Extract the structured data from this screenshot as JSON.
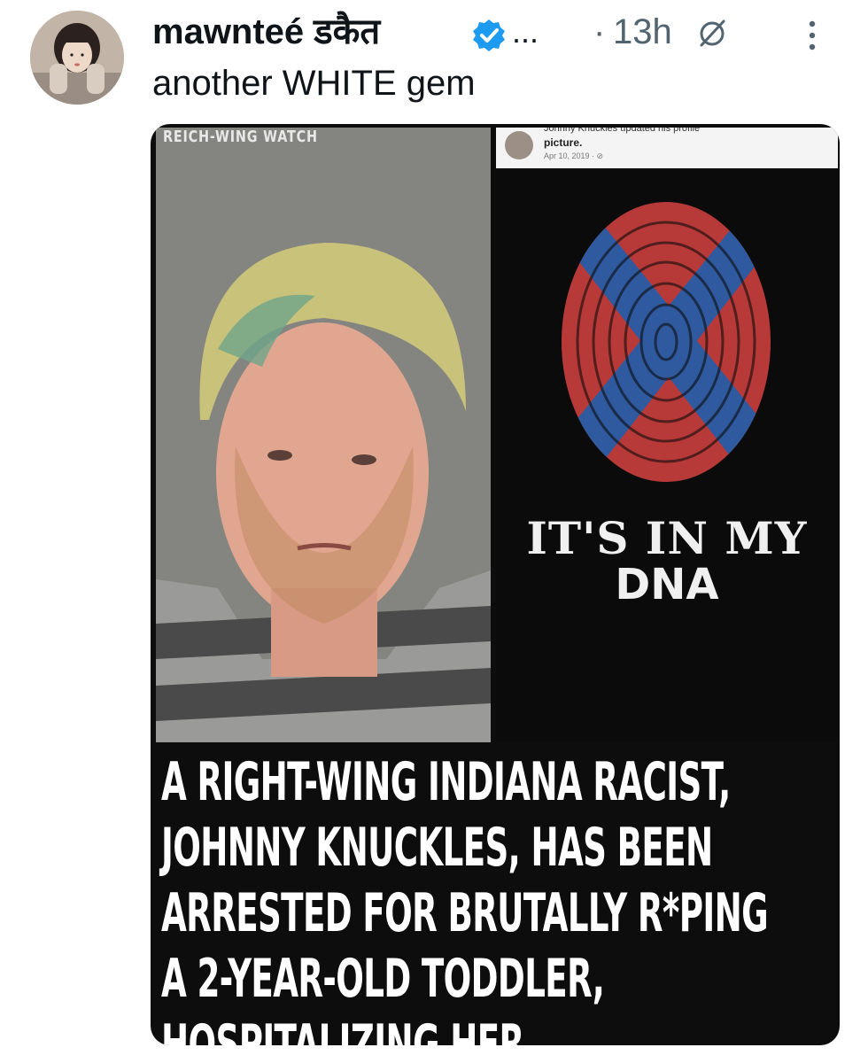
{
  "tweet": {
    "author_name": "mawnteé डकैत",
    "ellipsis": "...",
    "separator": "·",
    "timestamp": "13h",
    "text": "another WHITE gem",
    "icons": {
      "verified": "verified-badge-icon",
      "grok": "grok-icon",
      "more": "more-options-icon"
    },
    "colors": {
      "verified": "#1d9bf0",
      "secondary_text": "#536471"
    }
  },
  "media": {
    "watermark": "REICH-WING WATCH",
    "facebook_post": {
      "line1": "Johnny Knuckles updated his profile",
      "line2": "picture.",
      "date": "Apr 10, 2019 · ⊘"
    },
    "shirt_text": {
      "line1": "IT'S IN MY",
      "line2": "DNA"
    },
    "headline_lines": [
      "A RIGHT-WING INDIANA RACIST,",
      "JOHNNY KNUCKLES, HAS BEEN",
      "ARRESTED FOR BRUTALLY R*PING",
      "A 2-YEAR-OLD TODDLER,",
      "HOSPITALIZING HER."
    ]
  }
}
